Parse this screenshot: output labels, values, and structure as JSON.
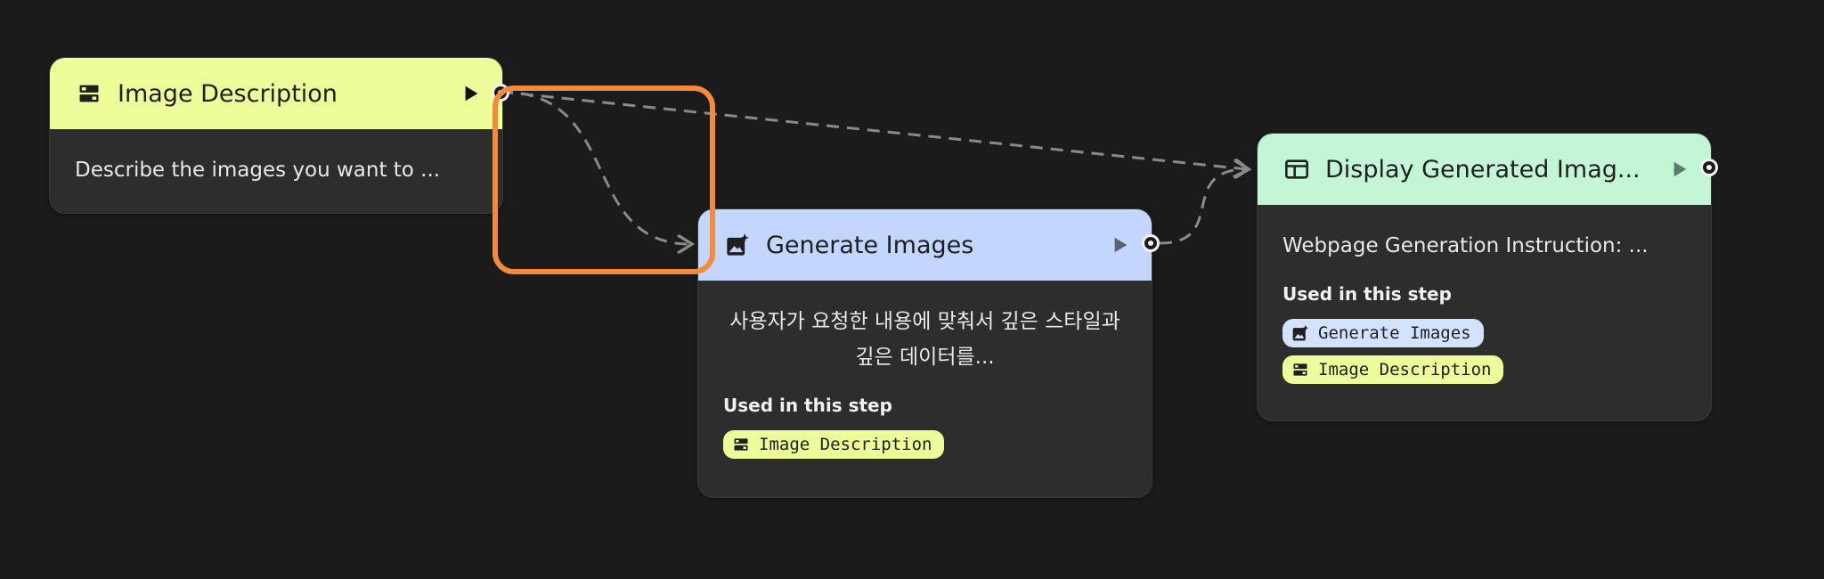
{
  "colors": {
    "background": "#1b1b1b",
    "node_body": "#2d2d2d",
    "yellow_header": "#eefc9a",
    "blue_header": "#c2d6ff",
    "green_header": "#c2f6d6",
    "chip_yellow": "#eefc9a",
    "chip_blue": "#d3e2ff",
    "connector": "#8a8a8a",
    "highlight": "#f58a3a"
  },
  "nodes": {
    "image_description": {
      "title": "Image Description",
      "icon": "text-input-icon",
      "description": "Describe the images you want to ..."
    },
    "generate_images": {
      "title": "Generate Images",
      "icon": "image-sparkle-icon",
      "description": "사용자가 요청한 내용에 맞춰서 깊은 스타일과 깊은 데이터를...",
      "used_label": "Used in this step",
      "chips": [
        {
          "label": "Image Description",
          "icon": "text-input-icon"
        }
      ]
    },
    "display_generated": {
      "title": "Display Generated Imag...",
      "icon": "web-layout-icon",
      "description": "Webpage Generation Instruction: ...",
      "used_label": "Used in this step",
      "chips": [
        {
          "label": "Generate Images",
          "icon": "image-sparkle-icon"
        },
        {
          "label": "Image Description",
          "icon": "text-input-icon"
        }
      ]
    }
  }
}
